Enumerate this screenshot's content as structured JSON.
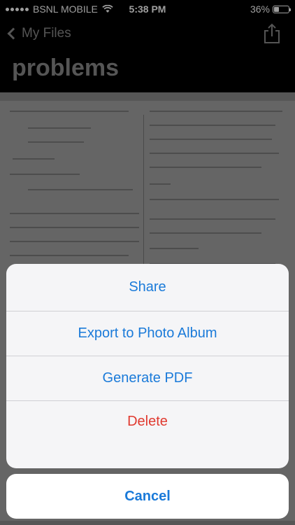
{
  "status_bar": {
    "carrier": "BSNL MOBILE",
    "time": "5:38 PM",
    "battery_percent_label": "36%",
    "battery_level": 0.36
  },
  "nav": {
    "back_label": "My Files",
    "share_icon": "share-icon"
  },
  "page_title": "problems",
  "action_sheet": {
    "items": [
      {
        "label": "Share",
        "style": "default"
      },
      {
        "label": "Export to Photo Album",
        "style": "default"
      },
      {
        "label": "Generate PDF",
        "style": "default"
      },
      {
        "label": "Delete",
        "style": "destructive"
      }
    ],
    "cancel_label": "Cancel"
  },
  "colors": {
    "accent": "#1a7ad9",
    "destructive": "#e0392f",
    "sheet_background": "#f5f5f7"
  }
}
